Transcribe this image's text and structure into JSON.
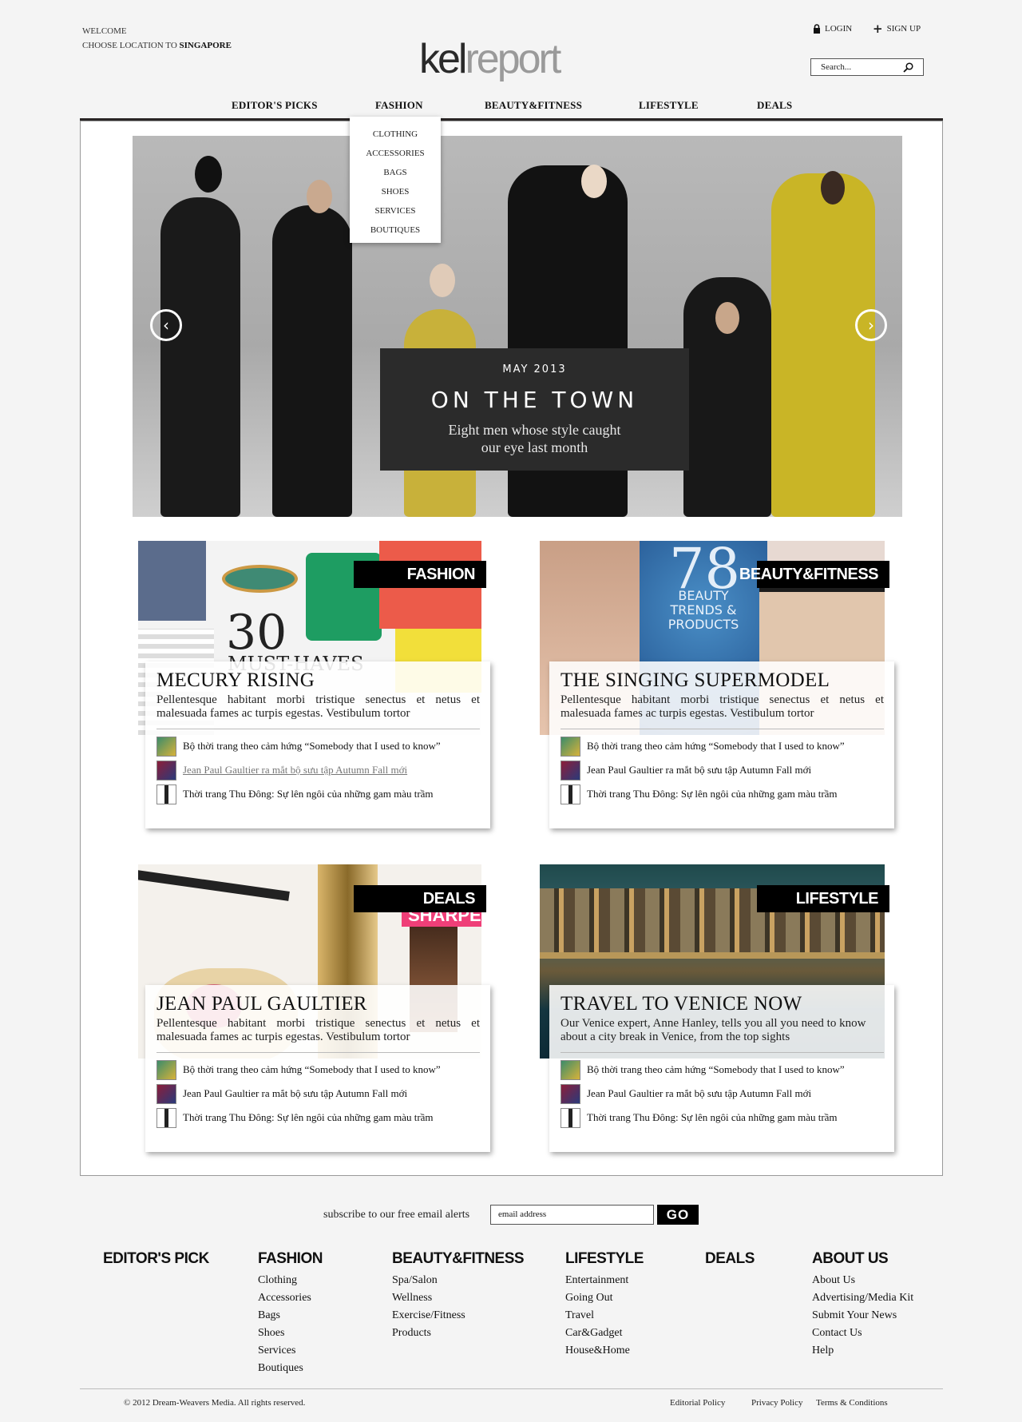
{
  "header": {
    "welcome": "WELCOME",
    "location_prefix": "CHOOSE LOCATION TO",
    "location": "SINGAPORE",
    "logo_part1": "kel",
    "logo_part2": "report",
    "login": "LOGIN",
    "signup": "SIGN UP",
    "search_placeholder": "Search..."
  },
  "nav": {
    "items": [
      "EDITOR'S PICKS",
      "FASHION",
      "BEAUTY&FITNESS",
      "LIFESTYLE",
      "DEALS"
    ],
    "dropdown": [
      "CLOTHING",
      "ACCESSORIES",
      "BAGS",
      "SHOES",
      "SERVICES",
      "BOUTIQUES"
    ]
  },
  "hero": {
    "date": "MAY 2013",
    "title": "ON THE TOWN",
    "subtitle_line1": "Eight men whose style caught",
    "subtitle_line2": "our eye last month"
  },
  "cards": [
    {
      "tag": "FASHION",
      "title": "MECURY RISING",
      "desc": "Pellentesque habitant morbi tristique senectus et netus et malesuada fames ac turpis egestas. Vestibulum tortor",
      "image_text_number": "30",
      "image_text_label": "MUST-HAVES",
      "links": [
        "Bộ thời trang theo cảm hứng “Somebody that I used to know”",
        "Jean Paul Gaultier ra mắt bộ sưu tập  Autumn Fall mới",
        "Thời trang Thu Đông: Sự lên ngôi của  những gam màu trầm"
      ]
    },
    {
      "tag": "BEAUTY&FITNESS",
      "title": "THE SINGING SUPERMODEL",
      "desc": "Pellentesque habitant morbi tristique senectus et netus et malesuada fames ac turpis egestas. Vestibulum tortor",
      "image_text_number": "78",
      "image_text_label": "BEAUTY TRENDS & PRODUCTS",
      "links": [
        "Bộ thời trang theo cảm hứng “Somebody that I used to know”",
        "Jean Paul Gaultier ra mắt bộ sưu tập  Autumn Fall mới",
        "Thời trang Thu Đông: Sự lên ngôi của  những gam màu trầm"
      ]
    },
    {
      "tag": "DEALS",
      "title": "JEAN PAUL GAULTIER",
      "desc": "Pellentesque habitant morbi tristique senectus et netus et malesuada fames ac turpis egestas. Vestibulum tortor",
      "image_text_label": "SHARPE",
      "links": [
        "Bộ thời trang theo cảm hứng “Somebody that I used to know”",
        "Jean Paul Gaultier ra mắt bộ sưu tập  Autumn Fall mới",
        "Thời trang Thu Đông: Sự lên ngôi của  những gam màu trầm"
      ]
    },
    {
      "tag": "LIFESTYLE",
      "title": "TRAVEL TO VENICE NOW",
      "desc": "Our Venice expert, Anne Hanley, tells you all you need to know about a city break in Venice, from the top sights",
      "links": [
        "Bộ thời trang theo cảm hứng “Somebody that I used to know”",
        "Jean Paul Gaultier ra mắt bộ sưu tập  Autumn Fall mới",
        "Thời trang Thu Đông: Sự lên ngôi của  những gam màu trầm"
      ]
    }
  ],
  "subscribe": {
    "label": "subscribe to our free email alerts",
    "placeholder": "email address",
    "button": "GO"
  },
  "footer": {
    "columns": [
      {
        "heading": "EDITOR'S PICK",
        "links": []
      },
      {
        "heading": "FASHION",
        "links": [
          "Clothing",
          "Accessories",
          "Bags",
          "Shoes",
          "Services",
          "Boutiques"
        ]
      },
      {
        "heading": "BEAUTY&FITNESS",
        "links": [
          "Spa/Salon",
          "Wellness",
          "Exercise/Fitness",
          "Products"
        ]
      },
      {
        "heading": "LIFESTYLE",
        "links": [
          "Entertainment",
          "Going Out",
          "Travel",
          "Car&Gadget",
          "House&Home"
        ]
      },
      {
        "heading": "DEALS",
        "links": []
      },
      {
        "heading": "ABOUT US",
        "links": [
          "About Us",
          "Advertising/Media Kit",
          "Submit Your News",
          "Contact Us",
          "Help"
        ]
      }
    ],
    "copyright": "© 2012 Dream-Weavers Media. All rights reserved.",
    "bottom_links": [
      "Editorial Policy",
      "Privacy Policy",
      "Terms & Conditions"
    ]
  },
  "colors": {
    "nav_bar": "#2a2626",
    "tag_bg": "#000000",
    "page_bg": "#f4f4f4"
  }
}
